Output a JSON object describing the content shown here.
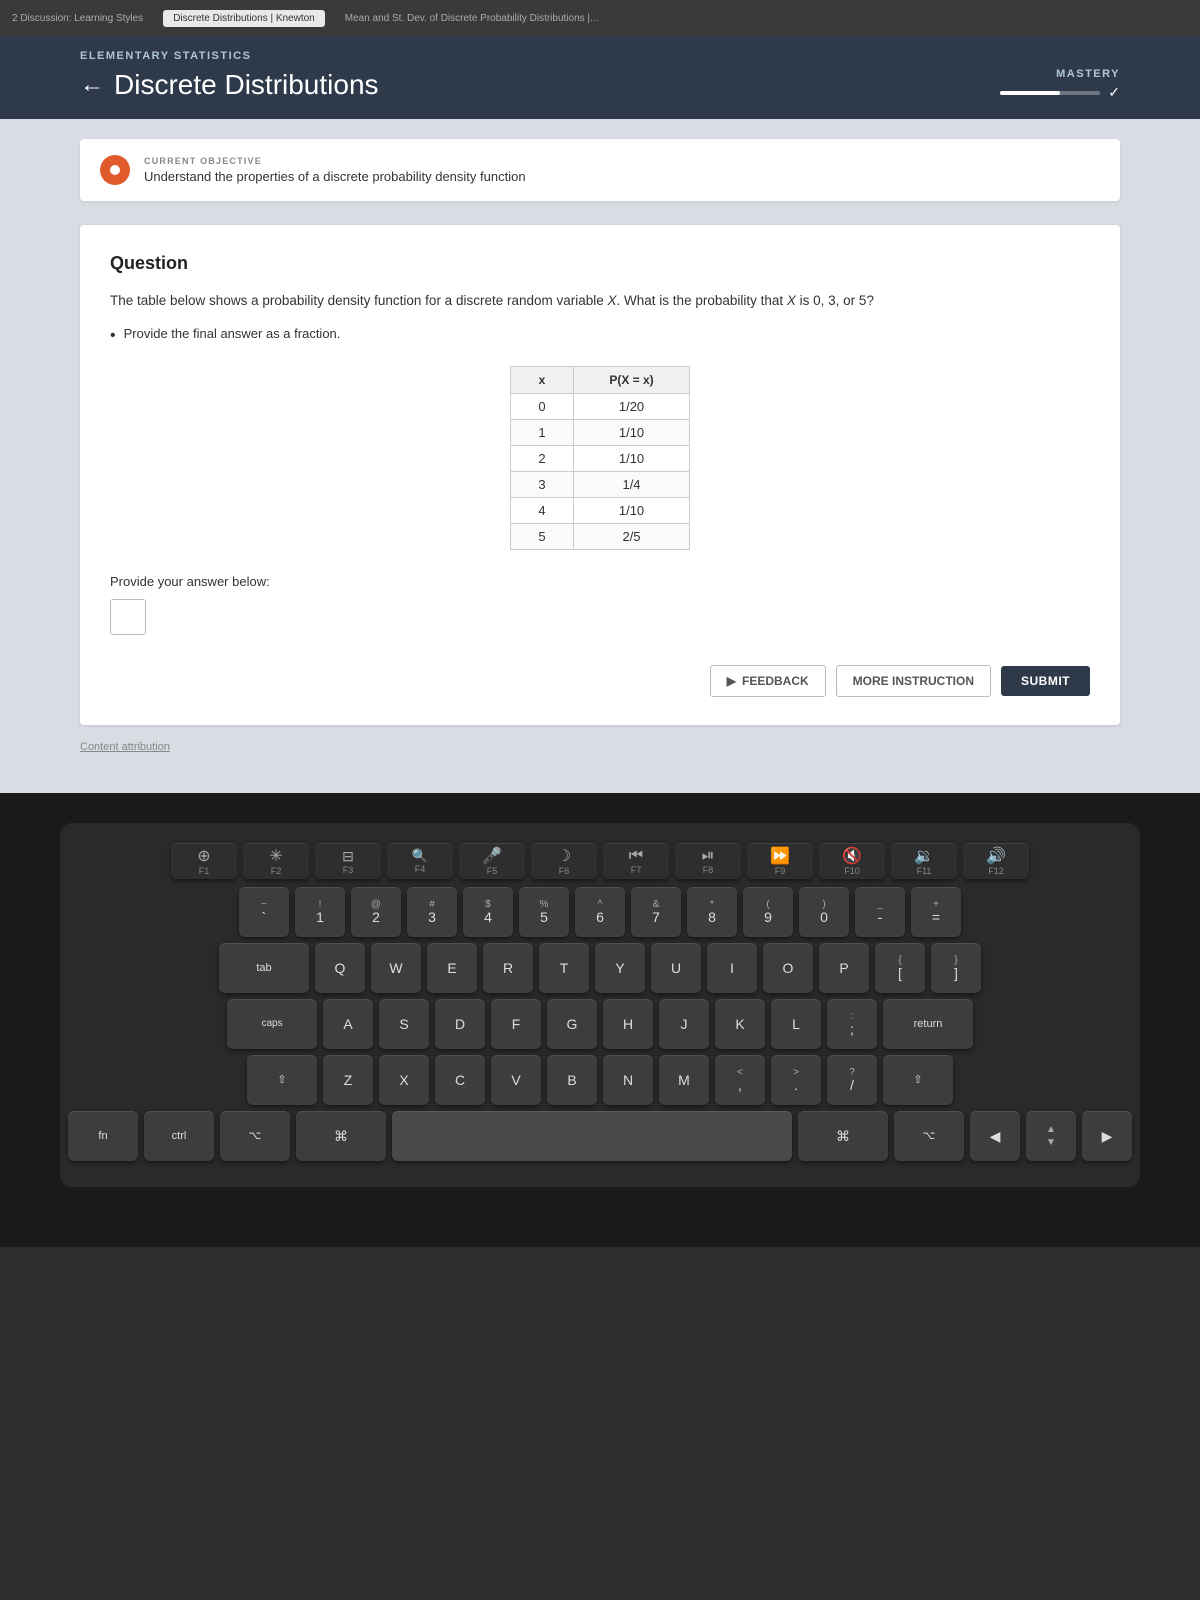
{
  "browser": {
    "tabs": [
      {
        "label": "2 Discussion: Learning Styles",
        "active": false
      },
      {
        "label": "Discrete Distributions | Knewton",
        "active": true
      },
      {
        "label": "Mean and St. Dev. of Discrete Probability Distributions |...",
        "active": false
      }
    ]
  },
  "header": {
    "course_label": "ELEMENTARY STATISTICS",
    "back_label": "←",
    "page_title": "Discrete Distributions",
    "mastery_label": "MASTERY",
    "mastery_check": "✓"
  },
  "objective": {
    "label": "CURRENT OBJECTIVE",
    "description": "Understand the properties of a discrete probability density function"
  },
  "question": {
    "heading": "Question",
    "text": "The table below shows a probability density function for a discrete random variable X. What is the probability that X is 0, 3, or 5?",
    "bullet": "Provide the final answer as a fraction.",
    "table_headers": [
      "x",
      "P(X = x)"
    ],
    "table_rows": [
      [
        "0",
        "1/20"
      ],
      [
        "1",
        "1/10"
      ],
      [
        "2",
        "1/10"
      ],
      [
        "3",
        "1/4"
      ],
      [
        "4",
        "1/10"
      ],
      [
        "5",
        "2/5"
      ]
    ],
    "answer_label": "Provide your answer below:",
    "btn_feedback": "FEEDBACK",
    "btn_more": "MORE INSTRUCTION",
    "btn_submit": "SUBMIT",
    "attribution": "Content attribution"
  },
  "keyboard": {
    "fn_row": [
      "F1",
      "F2",
      "F3",
      "F4",
      "F5",
      "F6",
      "F7",
      "F8",
      "F9",
      "F10",
      "F11",
      "F12"
    ],
    "fn_icons": [
      "⊕",
      "✳",
      "⊟",
      "🔍",
      "🎤",
      "☾",
      "⏮",
      "⏯",
      "⏩",
      "🔇",
      "🔉",
      "🔊"
    ],
    "row1": [
      {
        "top": "~",
        "main": "`"
      },
      {
        "top": "!",
        "main": "1"
      },
      {
        "top": "@",
        "main": "2"
      },
      {
        "top": "#",
        "main": "3"
      },
      {
        "top": "$",
        "main": "4"
      },
      {
        "top": "%",
        "main": "5"
      },
      {
        "top": "^",
        "main": "6"
      },
      {
        "top": "&",
        "main": "7"
      },
      {
        "top": "*",
        "main": "8"
      },
      {
        "top": "(",
        "main": "9"
      },
      {
        "top": ")",
        "main": "0"
      },
      {
        "top": "_",
        "main": "-"
      },
      {
        "top": "+",
        "main": "="
      }
    ],
    "row2": [
      "W",
      "E",
      "R",
      "T",
      "Y",
      "U",
      "I",
      "O",
      "P"
    ],
    "row3": [
      "S",
      "D",
      "F",
      "G",
      "H",
      "J",
      "K",
      "L"
    ],
    "row4": [
      "X",
      "C",
      "V",
      "B",
      "N",
      "M"
    ]
  }
}
